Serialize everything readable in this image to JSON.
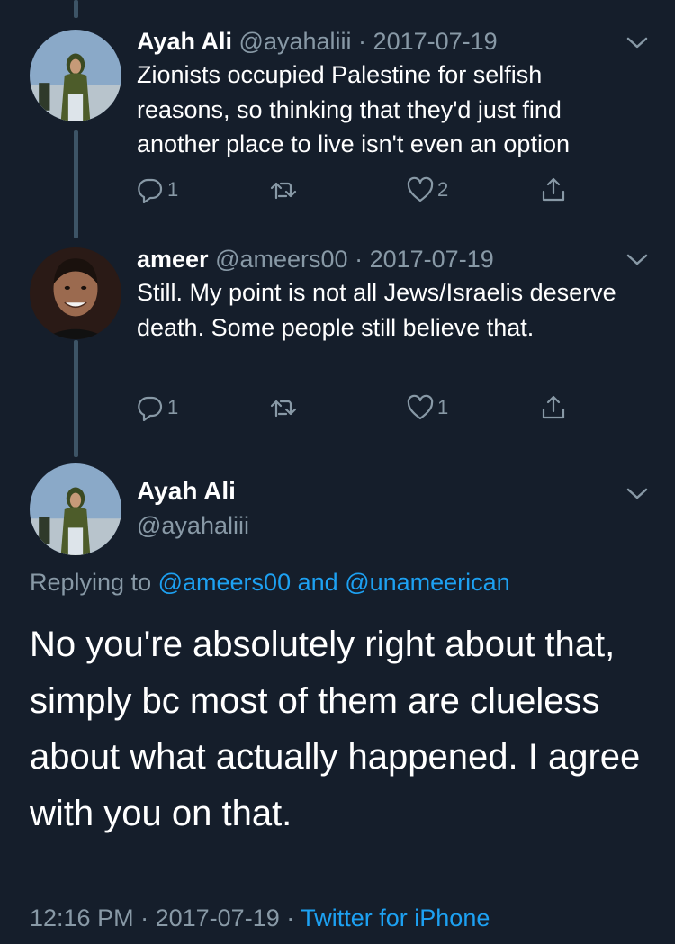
{
  "colors": {
    "background": "#151e2b",
    "secondary_text": "#8899a6",
    "link": "#1da1f2",
    "thread_line": "#3d5466"
  },
  "tweets": [
    {
      "name": "Ayah Ali",
      "handle": "@ayahaliii",
      "separator": "·",
      "date": "2017-07-19",
      "text": "Zionists occupied Palestine for selfish reasons, so thinking that they'd just find another place to live isn't even an option",
      "reply_count": "1",
      "like_count": "2"
    },
    {
      "name": "ameer",
      "handle": "@ameers00",
      "separator": "·",
      "date": "2017-07-19",
      "text": "Still. My point is not all Jews/Israelis deserve death. Some people still believe that.",
      "reply_count": "1",
      "like_count": "1"
    }
  ],
  "main_tweet": {
    "name": "Ayah Ali",
    "handle": "@ayahaliii",
    "replying_prefix": "Replying to",
    "replying_user1": "@ameers00",
    "replying_and": "and",
    "replying_user2": "@unameerican",
    "text": "No you're absolutely right about that, simply bc most of them are clueless about what actually happened. I agree with you on that.",
    "time": "12:16 PM",
    "separator": "·",
    "date": "2017-07-19",
    "source": "Twitter for iPhone"
  },
  "icons": [
    "reply-icon",
    "retweet-icon",
    "like-icon",
    "share-icon",
    "chevron-down-icon"
  ]
}
